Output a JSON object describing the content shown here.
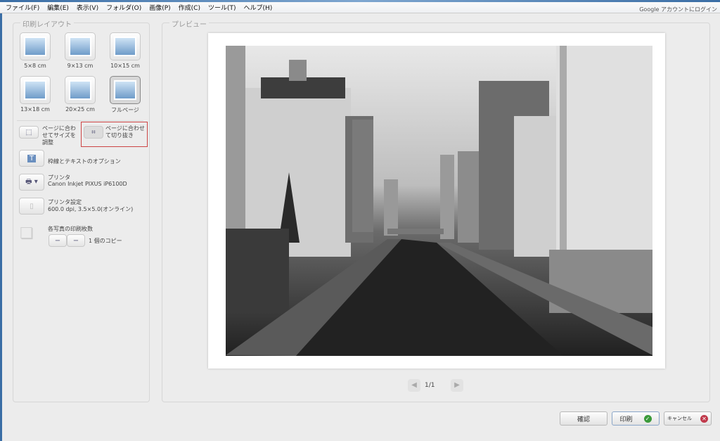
{
  "menu": [
    "ファイル(F)",
    "編集(E)",
    "表示(V)",
    "フォルダ(O)",
    "画像(P)",
    "作成(C)",
    "ツール(T)",
    "ヘルプ(H)"
  ],
  "account_link": "Google アカウントにログイン",
  "layout_panel": {
    "title": "印刷レイアウト",
    "sizes": [
      "5×8 cm",
      "9×13 cm",
      "10×15 cm",
      "13×18 cm",
      "20×25 cm",
      "フルページ"
    ],
    "selected": "フルページ",
    "fit_resize": "ページに合わせてサイズを調整",
    "fit_crop": "ページに合わせて切り抜き",
    "border_text_options": "枠線とテキストのオプション",
    "printer_label": "プリンタ",
    "printer_name": "Canon Inkjet PIXUS iP6100D",
    "printer_settings_label": "プリンタ設定",
    "printer_settings_value": "600.0 dpi, 3.5×5.0(オンライン)",
    "copies_label": "各写真の印刷枚数",
    "minus": "−",
    "plus": "−",
    "copies_value": "1 個のコピー"
  },
  "preview": {
    "title": "プレビュー",
    "page": "1/1"
  },
  "buttons": {
    "confirm": "確認",
    "print": "印刷",
    "cancel": "キャンセル"
  }
}
